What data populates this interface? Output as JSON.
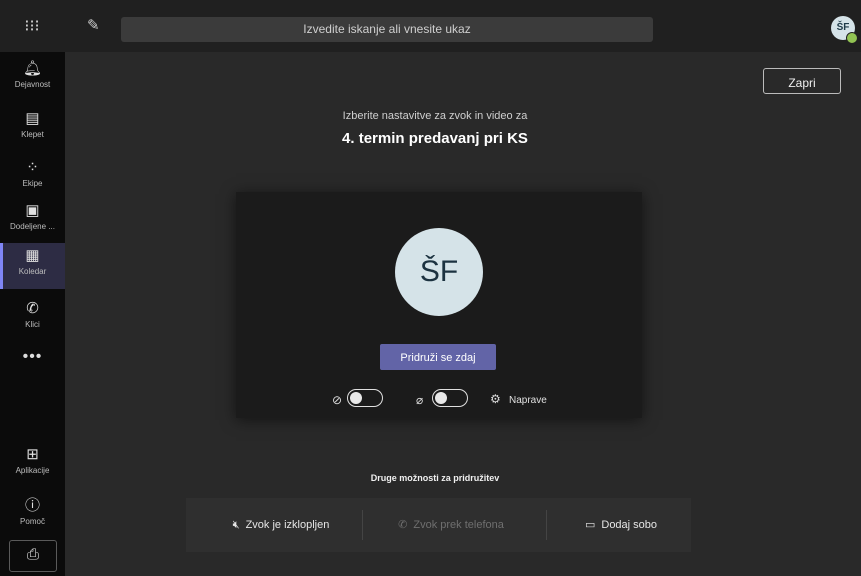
{
  "header": {
    "search_placeholder": "Izvedite iskanje ali vnesite ukaz",
    "user_initials": "ŠF"
  },
  "rail": {
    "items": [
      {
        "label": "Dejavnost",
        "icon": "bell-icon"
      },
      {
        "label": "Klepet",
        "icon": "chat-icon"
      },
      {
        "label": "Ekipe",
        "icon": "teams-icon"
      },
      {
        "label": "Dodeljene ...",
        "icon": "assignments-icon"
      },
      {
        "label": "Koledar",
        "icon": "calendar-icon"
      },
      {
        "label": "Klici",
        "icon": "phone-icon"
      }
    ],
    "more": "•••",
    "apps_label": "Aplikacije",
    "help_label": "Pomoč"
  },
  "main": {
    "close_label": "Zapri",
    "subtitle": "Izberite nastavitve za zvok in video za",
    "meeting_title": "4. termin predavanj pri KS",
    "avatar_initials": "ŠF",
    "join_label": "Pridruži se zdaj",
    "devices_label": "Naprave",
    "camera_on": false,
    "mic_on": false,
    "other_title": "Druge možnosti za pridružitev",
    "options": [
      {
        "label": "Zvok je izklopljen",
        "icon": "speaker-off-icon",
        "enabled": true
      },
      {
        "label": "Zvok prek telefona",
        "icon": "phone-icon",
        "enabled": false
      },
      {
        "label": "Dodaj sobo",
        "icon": "room-icon",
        "enabled": true
      }
    ]
  },
  "colors": {
    "accent": "#6264a7",
    "rail_active": "#2d2c44",
    "presence_available": "#92c353"
  }
}
